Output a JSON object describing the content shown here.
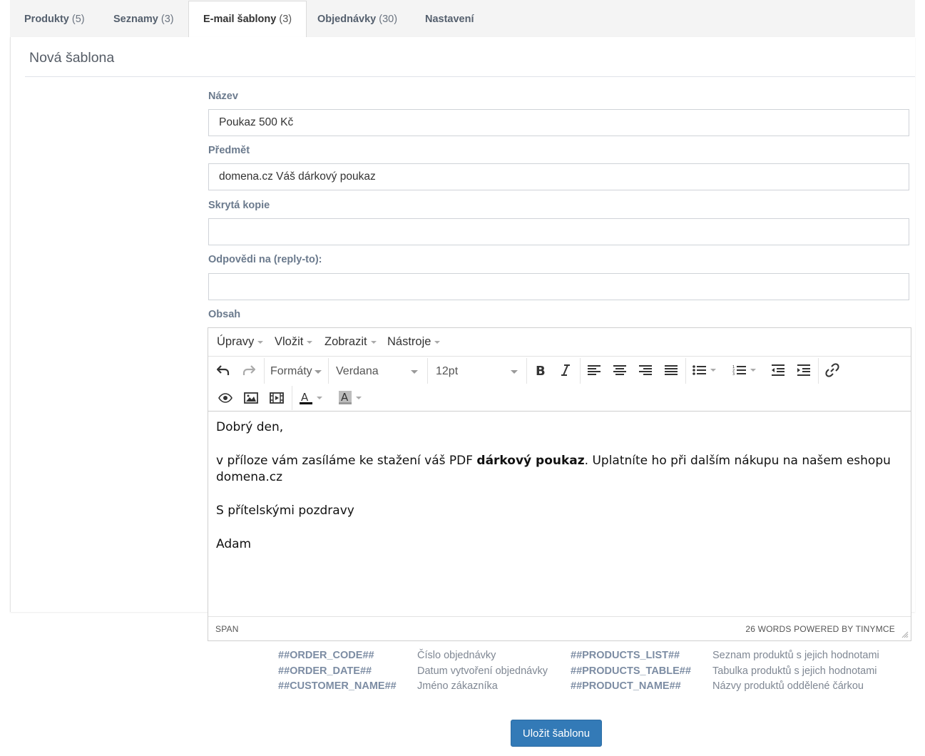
{
  "tabs": [
    {
      "label": "Produkty",
      "count": "(5)"
    },
    {
      "label": "Seznamy",
      "count": "(3)"
    },
    {
      "label": "E-mail šablony",
      "count": "(3)",
      "active": true
    },
    {
      "label": "Objednávky",
      "count": "(30)"
    },
    {
      "label": "Nastavení",
      "count": ""
    }
  ],
  "panel": {
    "title": "Nová šablona"
  },
  "form": {
    "name": {
      "label": "Název",
      "value": "Poukaz 500 Kč"
    },
    "subject": {
      "label": "Předmět",
      "value": "domena.cz Váš dárkový poukaz"
    },
    "bcc": {
      "label": "Skrytá kopie",
      "value": ""
    },
    "reply_to": {
      "label": "Odpovědi na (reply-to):",
      "value": ""
    },
    "content_label": "Obsah"
  },
  "editor": {
    "menu": [
      "Úpravy",
      "Vložit",
      "Zobrazit",
      "Nástroje"
    ],
    "formats_label": "Formáty",
    "font_family": "Verdana",
    "font_size": "12pt",
    "body": {
      "greeting": "Dobrý den,",
      "line_before_bold": "v příloze vám zasíláme ke stažení váš PDF ",
      "bold": "dárkový poukaz",
      "line_after_bold": ". Uplatníte ho při dalším nákupu na našem eshopu domena.cz",
      "closing": "S přítelskými pozdravy",
      "signature": "Adam"
    },
    "status_path": "SPAN",
    "status_right": "26 WORDS POWERED BY TINYMCE"
  },
  "placeholders": [
    {
      "code": "##ORDER_CODE##",
      "desc": "Číslo objednávky"
    },
    {
      "code": "##ORDER_DATE##",
      "desc": "Datum vytvoření objednávky"
    },
    {
      "code": "##CUSTOMER_NAME##",
      "desc": "Jméno zákazníka"
    },
    {
      "code": "##PRODUCTS_LIST##",
      "desc": "Seznam produktů s jejich hodnotami"
    },
    {
      "code": "##PRODUCTS_TABLE##",
      "desc": "Tabulka produktů s jejich hodnotami"
    },
    {
      "code": "##PRODUCT_NAME##",
      "desc": "Názvy produktů oddělené čárkou"
    }
  ],
  "save_label": "Uložit šablonu",
  "colors": {
    "primary": "#337ab7",
    "label": "#6b7a8d",
    "tab_text": "#55606e"
  },
  "icons": [
    "undo-icon",
    "redo-icon",
    "bold-icon",
    "italic-icon",
    "align-left-icon",
    "align-center-icon",
    "align-right-icon",
    "align-justify-icon",
    "bullet-list-icon",
    "numbered-list-icon",
    "outdent-icon",
    "indent-icon",
    "link-icon",
    "preview-icon",
    "image-icon",
    "media-icon",
    "text-color-icon",
    "background-color-icon"
  ]
}
